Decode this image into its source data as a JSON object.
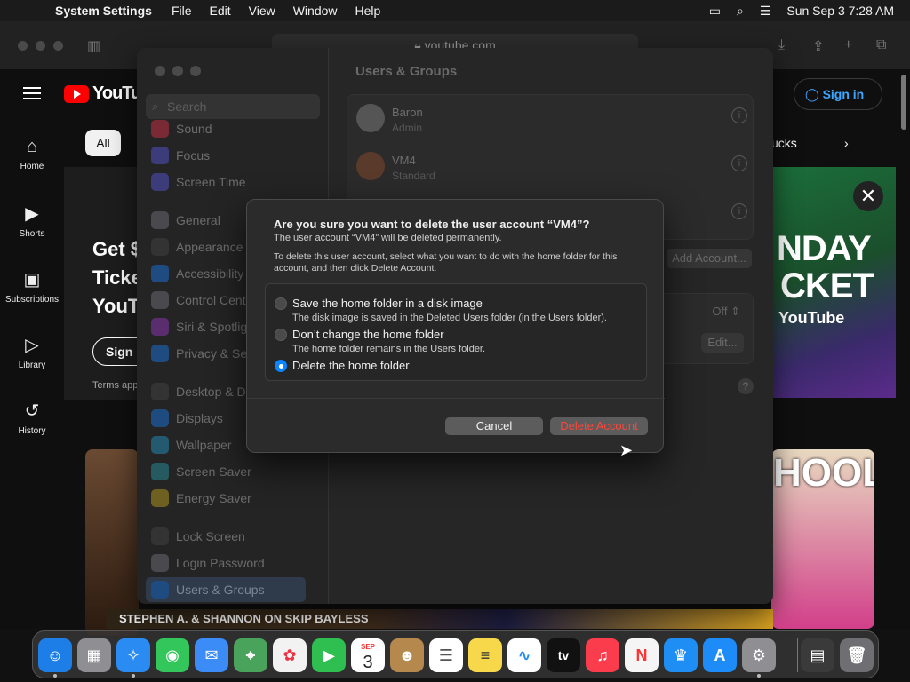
{
  "menubar": {
    "apple": "",
    "app": "System Settings",
    "menus": [
      "File",
      "Edit",
      "View",
      "Window",
      "Help"
    ],
    "datetime": "Sun Sep 3  7:28 AM"
  },
  "safari": {
    "url": "youtube.com"
  },
  "youtube": {
    "sidebar": [
      {
        "label": "Home",
        "icon": "home-icon"
      },
      {
        "label": "Shorts",
        "icon": "shorts-icon"
      },
      {
        "label": "Subscriptions",
        "icon": "subscriptions-icon"
      },
      {
        "label": "Library",
        "icon": "library-icon"
      },
      {
        "label": "History",
        "icon": "history-icon"
      }
    ],
    "logo": "YouTube",
    "sign_in": "Sign in",
    "chip_all": "All",
    "chip_right": "ucks",
    "ad_lines": [
      "Get $",
      "Ticke",
      "YouT"
    ],
    "ad_sign": "Sign u",
    "ad_terms": "Terms app",
    "banner_line1": "NDAY",
    "banner_line2": "CKET",
    "banner_brand": "YouTube",
    "thumb_title": "HOOL",
    "strip_text": "STEPHEN A. & SHANNON ON SKIP BAYLESS"
  },
  "settings": {
    "search_placeholder": "Search",
    "sidebar_items": [
      {
        "label": "Sound",
        "color": "#d0344c"
      },
      {
        "label": "Focus",
        "color": "#5e5ce6"
      },
      {
        "label": "Screen Time",
        "color": "#5e5ce6"
      },
      {
        "label": "General",
        "color": "#8e8e93"
      },
      {
        "label": "Appearance",
        "color": "#1c1c1e"
      },
      {
        "label": "Accessibility",
        "color": "#0a84ff"
      },
      {
        "label": "Control Centre",
        "color": "#8e8e93"
      },
      {
        "label": "Siri & Spotlight",
        "color": "#bf5af2"
      },
      {
        "label": "Privacy & Security",
        "color": "#0a84ff"
      },
      {
        "label": "Desktop & Dock",
        "color": "#1c1c1e"
      },
      {
        "label": "Displays",
        "color": "#0a84ff"
      },
      {
        "label": "Wallpaper",
        "color": "#32ade6"
      },
      {
        "label": "Screen Saver",
        "color": "#30b0c7"
      },
      {
        "label": "Energy Saver",
        "color": "#ffd60a"
      },
      {
        "label": "Lock Screen",
        "color": "#1c1c1e"
      },
      {
        "label": "Login Password",
        "color": "#8e8e93"
      },
      {
        "label": "Users & Groups",
        "color": "#0a84ff"
      }
    ],
    "title": "Users & Groups",
    "users": [
      {
        "name": "Baron",
        "role": "Admin"
      },
      {
        "name": "VM4",
        "role": "Standard"
      }
    ],
    "add_account": "Add Account...",
    "off_label": "Off",
    "edit_label": "Edit...",
    "help": "?"
  },
  "dialog": {
    "heading": "Are you sure you want to delete the user account “VM4”?",
    "subheading": "The user account “VM4” will be deleted permanently.",
    "instructions": "To delete this user account, select what you want to do with the home folder for this account, and then click Delete Account.",
    "options": [
      {
        "label": "Save the home folder in a disk image",
        "desc": "The disk image is saved in the Deleted Users folder (in the Users folder).",
        "selected": false
      },
      {
        "label": "Don’t change the home folder",
        "desc": "The home folder remains in the Users folder.",
        "selected": false
      },
      {
        "label": "Delete the home folder",
        "desc": "",
        "selected": true
      }
    ],
    "cancel": "Cancel",
    "delete": "Delete Account"
  },
  "dock": {
    "calendar_month": "SEP",
    "calendar_day": "3",
    "tv_label": "tv",
    "apps": [
      {
        "name": "finder-icon",
        "color": "#1e7ee8"
      },
      {
        "name": "launchpad-icon",
        "color": "#c0c0c0"
      },
      {
        "name": "safari-icon",
        "color": "#2a8bf2"
      },
      {
        "name": "messages-icon",
        "color": "#33c65a"
      },
      {
        "name": "mail-icon",
        "color": "#3b8cf6"
      },
      {
        "name": "maps-icon",
        "color": "#4aa35a"
      },
      {
        "name": "photos-icon",
        "color": "#f2f2f2"
      },
      {
        "name": "facetime-icon",
        "color": "#2fbf50"
      },
      {
        "name": "calendar-icon",
        "color": "#ffffff"
      },
      {
        "name": "contacts-icon",
        "color": "#b5884e"
      },
      {
        "name": "reminders-icon",
        "color": "#ffffff"
      },
      {
        "name": "notes-icon",
        "color": "#f7d84a"
      },
      {
        "name": "freeform-icon",
        "color": "#ffffff"
      },
      {
        "name": "tv-icon",
        "color": "#111111"
      },
      {
        "name": "music-icon",
        "color": "#fa3c4c"
      },
      {
        "name": "news-icon",
        "color": "#f5f5f5"
      },
      {
        "name": "keynote-icon",
        "color": "#1e8ef5"
      },
      {
        "name": "app-store-icon",
        "color": "#1d8cf8"
      },
      {
        "name": "system-settings-icon",
        "color": "#8e8e93"
      },
      {
        "name": "downloads-icon",
        "color": "#3a3a3a"
      },
      {
        "name": "trash-icon",
        "color": "#6e6e73"
      }
    ]
  }
}
